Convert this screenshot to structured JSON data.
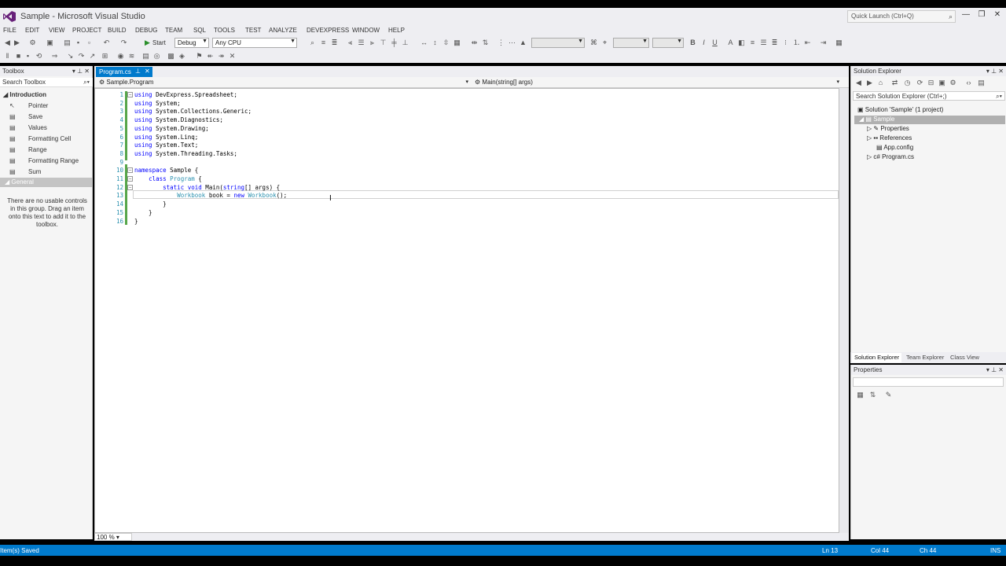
{
  "window": {
    "title": "Sample - Microsoft Visual Studio",
    "quick_launch": "Quick Launch (Ctrl+Q)",
    "controls": [
      "—",
      "❐",
      "✕"
    ]
  },
  "menu": [
    "FILE",
    "EDIT",
    "VIEW",
    "PROJECT",
    "BUILD",
    "DEBUG",
    "TEAM",
    "SQL",
    "TOOLS",
    "TEST",
    "ANALYZE",
    "DEVEXPRESS",
    "WINDOW",
    "HELP"
  ],
  "toolbar": {
    "start_label": "Start",
    "config": "Debug",
    "platform": "Any CPU"
  },
  "toolbox": {
    "title": "Toolbox",
    "search_placeholder": "Search Toolbox",
    "group": "Introduction",
    "items": [
      {
        "label": "Pointer",
        "icon": "pointer-icon"
      },
      {
        "label": "Save",
        "icon": "control-icon"
      },
      {
        "label": "Values",
        "icon": "control-icon"
      },
      {
        "label": "Formatting Cell",
        "icon": "control-icon"
      },
      {
        "label": "Range",
        "icon": "control-icon"
      },
      {
        "label": "Formatting Range",
        "icon": "control-icon"
      },
      {
        "label": "Sum",
        "icon": "control-icon"
      }
    ],
    "general_group": "General",
    "empty_message": "There are no usable controls in this group. Drag an item onto this text to add it to the toolbox."
  },
  "editor": {
    "tab_label": "Program.cs",
    "nav_left": "Sample.Program",
    "nav_right": "Main(string[] args)",
    "zoom": "100 %",
    "lines": [
      {
        "n": "1",
        "tokens": [
          {
            "t": "using",
            "c": "kw"
          },
          {
            "t": " DevExpress.Spreadsheet;"
          }
        ],
        "fold": "−"
      },
      {
        "n": "2",
        "tokens": [
          {
            "t": "using",
            "c": "kw"
          },
          {
            "t": " System;"
          }
        ]
      },
      {
        "n": "3",
        "tokens": [
          {
            "t": "using",
            "c": "kw"
          },
          {
            "t": " System.Collections.Generic;"
          }
        ]
      },
      {
        "n": "4",
        "tokens": [
          {
            "t": "using",
            "c": "kw"
          },
          {
            "t": " System.Diagnostics;"
          }
        ]
      },
      {
        "n": "5",
        "tokens": [
          {
            "t": "using",
            "c": "kw"
          },
          {
            "t": " System.Drawing;"
          }
        ]
      },
      {
        "n": "6",
        "tokens": [
          {
            "t": "using",
            "c": "kw"
          },
          {
            "t": " System.Linq;"
          }
        ]
      },
      {
        "n": "7",
        "tokens": [
          {
            "t": "using",
            "c": "kw"
          },
          {
            "t": " System.Text;"
          }
        ]
      },
      {
        "n": "8",
        "tokens": [
          {
            "t": "using",
            "c": "kw"
          },
          {
            "t": " System.Threading.Tasks;"
          }
        ]
      },
      {
        "n": "9",
        "tokens": []
      },
      {
        "n": "10",
        "tokens": [
          {
            "t": "namespace",
            "c": "kw"
          },
          {
            "t": " Sample {"
          }
        ],
        "fold": "−"
      },
      {
        "n": "11",
        "tokens": [
          {
            "t": "    "
          },
          {
            "t": "class",
            "c": "kw"
          },
          {
            "t": " "
          },
          {
            "t": "Program",
            "c": "ty"
          },
          {
            "t": " {"
          }
        ],
        "fold": "−"
      },
      {
        "n": "12",
        "tokens": [
          {
            "t": "        "
          },
          {
            "t": "static",
            "c": "kw"
          },
          {
            "t": " "
          },
          {
            "t": "void",
            "c": "kw"
          },
          {
            "t": " Main("
          },
          {
            "t": "string",
            "c": "kw"
          },
          {
            "t": "[] args) {"
          }
        ],
        "fold": "−"
      },
      {
        "n": "13",
        "tokens": [
          {
            "t": "            "
          },
          {
            "t": "Workbook",
            "c": "ty"
          },
          {
            "t": " book = "
          },
          {
            "t": "new",
            "c": "kw"
          },
          {
            "t": " "
          },
          {
            "t": "Workbook",
            "c": "ty"
          },
          {
            "t": "();"
          }
        ]
      },
      {
        "n": "14",
        "tokens": [
          {
            "t": "        }"
          }
        ]
      },
      {
        "n": "15",
        "tokens": [
          {
            "t": "    }"
          }
        ]
      },
      {
        "n": "16",
        "tokens": [
          {
            "t": "}"
          }
        ]
      }
    ]
  },
  "solution_explorer": {
    "title": "Solution Explorer",
    "search_placeholder": "Search Solution Explorer (Ctrl+;)",
    "solution": "Solution 'Sample' (1 project)",
    "project": "Sample",
    "children": [
      {
        "label": "Properties",
        "icon": "wrench-icon",
        "expandable": true
      },
      {
        "label": "References",
        "icon": "references-icon",
        "expandable": true
      },
      {
        "label": "App.config",
        "icon": "config-file-icon",
        "expandable": false
      },
      {
        "label": "Program.cs",
        "icon": "csharp-file-icon",
        "expandable": true
      }
    ],
    "tabs": [
      "Solution Explorer",
      "Team Explorer",
      "Class View"
    ]
  },
  "properties": {
    "title": "Properties"
  },
  "status": {
    "message": "Item(s) Saved",
    "ln": "Ln 13",
    "col": "Col 44",
    "ch": "Ch 44",
    "mode": "INS"
  },
  "colors": {
    "accent": "#007acc",
    "keyword": "#0000ff",
    "type": "#2b91af"
  }
}
